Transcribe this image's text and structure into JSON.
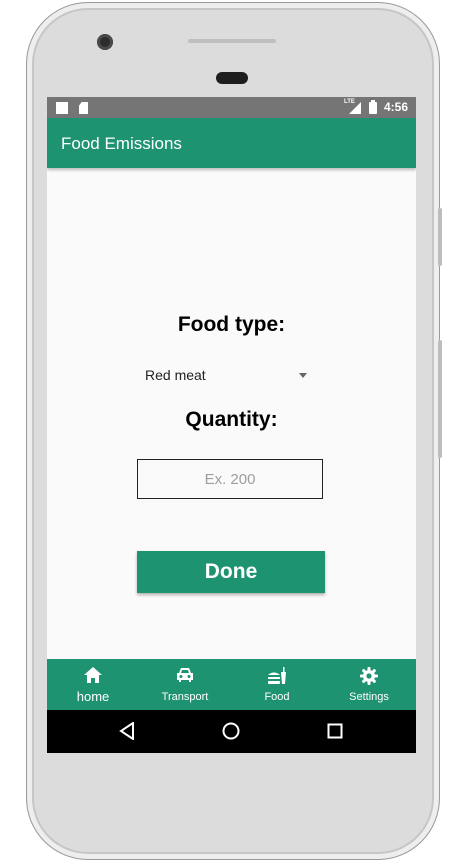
{
  "status_bar": {
    "network": "LTE",
    "time": "4:56"
  },
  "app_bar": {
    "title": "Food Emissions"
  },
  "form": {
    "food_type_label": "Food type:",
    "food_type_selected": "Red meat",
    "quantity_label": "Quantity:",
    "quantity_value": "",
    "quantity_placeholder": "Ex. 200",
    "done_label": "Done"
  },
  "bottom_nav": {
    "items": [
      {
        "label": "home",
        "icon": "home-icon",
        "active": true
      },
      {
        "label": "Transport",
        "icon": "car-icon",
        "active": false
      },
      {
        "label": "Food",
        "icon": "fastfood-icon",
        "active": false
      },
      {
        "label": "Settings",
        "icon": "gear-icon",
        "active": false
      }
    ]
  },
  "system_nav": {
    "buttons": [
      "back-icon",
      "home-circle-icon",
      "recents-icon"
    ]
  },
  "colors": {
    "primary": "#1e9371",
    "status_bar": "#757575",
    "background": "#fafafa",
    "system_nav": "#000000"
  }
}
